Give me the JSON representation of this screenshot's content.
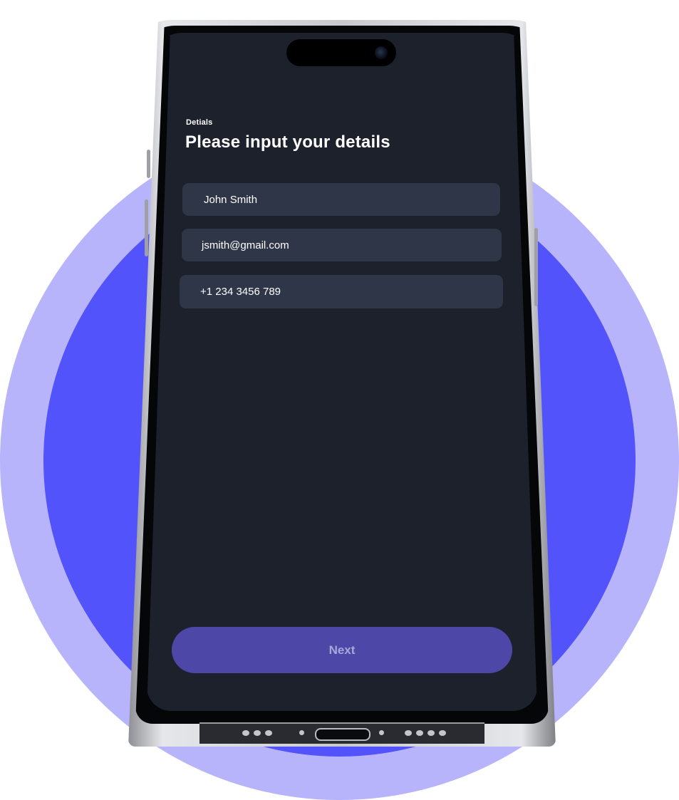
{
  "form": {
    "eyebrow": "Detials",
    "title": "Please input your details",
    "fields": [
      {
        "name": "full-name",
        "value": "John Smith"
      },
      {
        "name": "email",
        "value": "jsmith@gmail.com"
      },
      {
        "name": "phone",
        "value": "+1 234 3456 789"
      }
    ],
    "next_label": "Next"
  },
  "colors": {
    "outer_ring": "#b7b4fb",
    "inner_circle": "#5353fb",
    "screen_bg": "#1d212b",
    "field_bg": "#2e3647",
    "button_bg": "#4d47a8",
    "button_text": "#a9a7d9"
  }
}
